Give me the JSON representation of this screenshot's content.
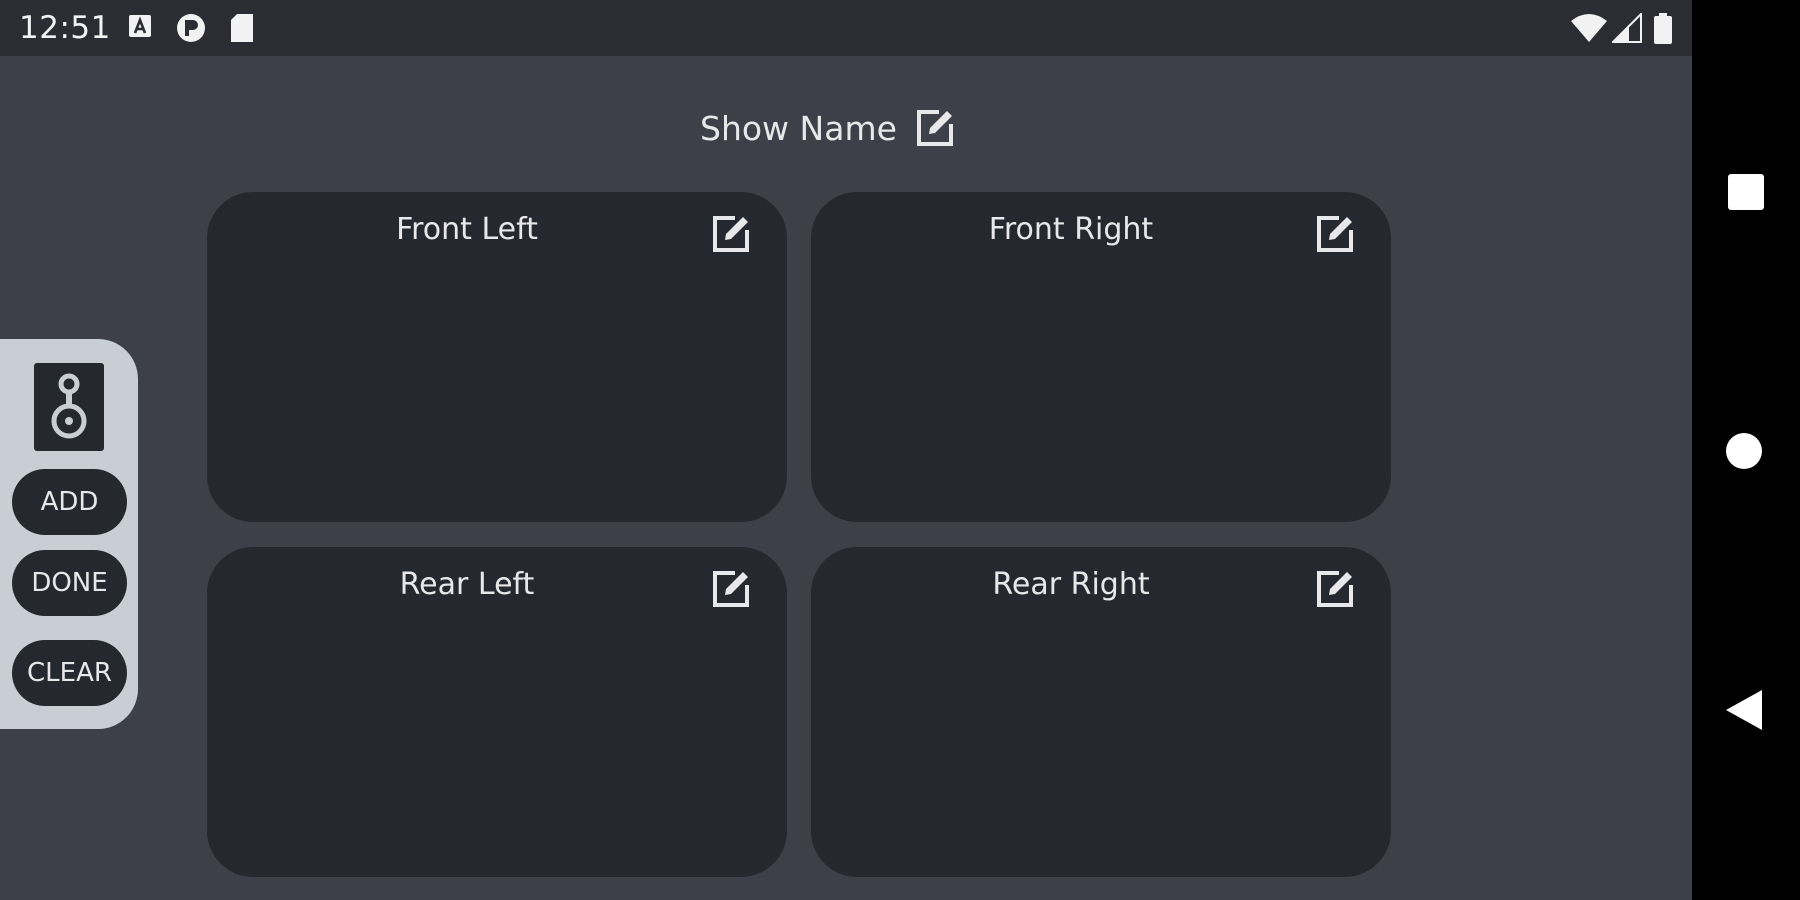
{
  "status_bar": {
    "time": "12:51",
    "left_icons": [
      "notification-a-icon",
      "circle-app-icon",
      "sd-card-icon"
    ],
    "right_icons": [
      "wifi-icon",
      "cell-signal-icon",
      "battery-icon"
    ]
  },
  "header": {
    "show_name": "Show Name"
  },
  "zones": [
    {
      "label": "Front Left"
    },
    {
      "label": "Front Right"
    },
    {
      "label": "Rear Left"
    },
    {
      "label": "Rear Right"
    }
  ],
  "toolbox": {
    "icon": "speaker-icon",
    "add_label": "ADD",
    "done_label": "DONE",
    "clear_label": "CLEAR"
  },
  "nav": {
    "buttons": [
      "recents-square-icon",
      "home-circle-icon",
      "back-triangle-icon"
    ]
  },
  "colors": {
    "background": "#3d4049",
    "card": "#262830",
    "status_bar": "#2b2d33",
    "toolbox": "#c9ced6",
    "text": "#e8e8ea"
  }
}
